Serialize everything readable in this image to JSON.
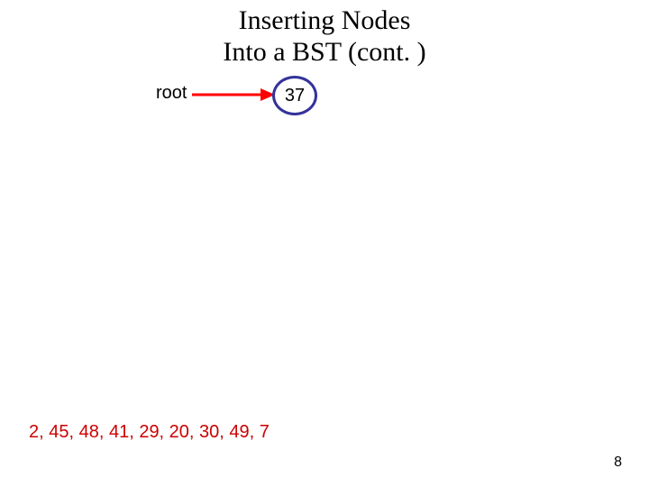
{
  "title_line1": "Inserting Nodes",
  "title_line2": "Into a BST (cont. )",
  "root_label": "root",
  "nodes": {
    "root": {
      "value": "37"
    }
  },
  "sequence_text": "2, 45, 48, 41, 29, 20, 30, 49, 7",
  "page_number": "8",
  "colors": {
    "node_border": "#333399",
    "arrow": "#ff0000",
    "sequence": "#cc0000"
  }
}
